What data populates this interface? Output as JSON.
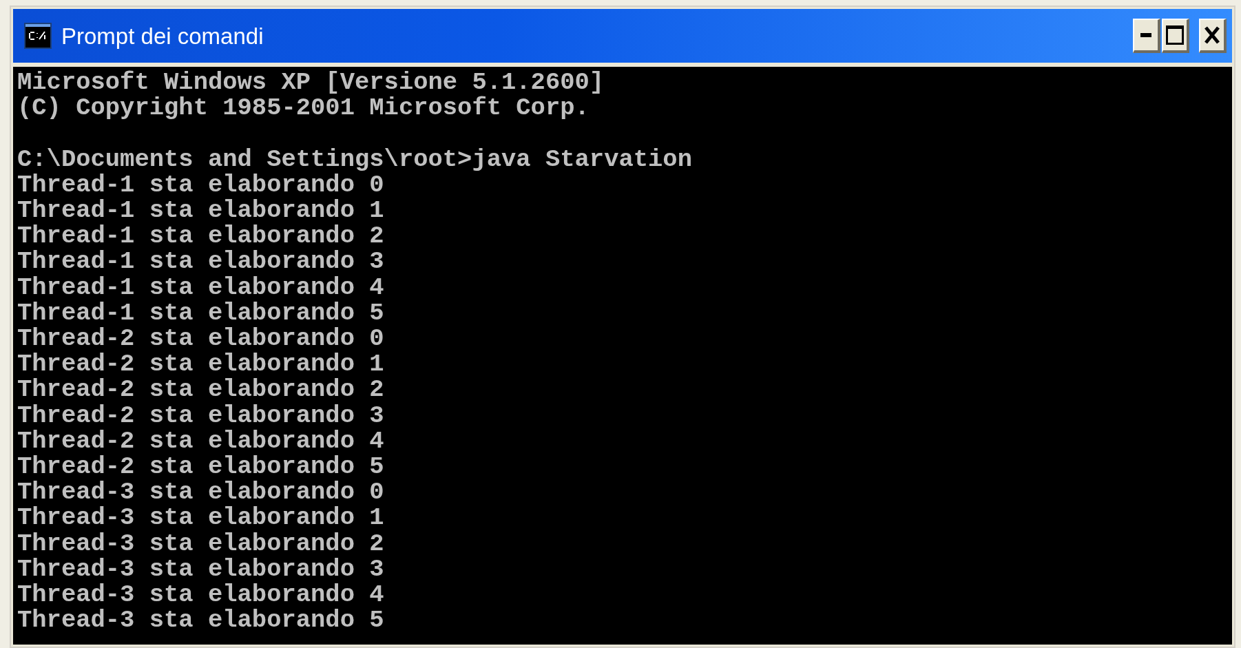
{
  "window": {
    "title": "Prompt dei comandi"
  },
  "console": {
    "blocks": [
      [
        "Microsoft Windows XP [Versione 5.1.2600]",
        "(C) Copyright 1985-2001 Microsoft Corp."
      ],
      [
        "C:\\Documents and Settings\\root>java Starvation",
        "Thread-1 sta elaborando 0",
        "Thread-1 sta elaborando 1",
        "Thread-1 sta elaborando 2",
        "Thread-1 sta elaborando 3",
        "Thread-1 sta elaborando 4",
        "Thread-1 sta elaborando 5",
        "Thread-2 sta elaborando 0",
        "Thread-2 sta elaborando 1",
        "Thread-2 sta elaborando 2",
        "Thread-2 sta elaborando 3",
        "Thread-2 sta elaborando 4",
        "Thread-2 sta elaborando 5",
        "Thread-3 sta elaborando 0",
        "Thread-3 sta elaborando 1",
        "Thread-3 sta elaborando 2",
        "Thread-3 sta elaborando 3",
        "Thread-3 sta elaborando 4",
        "Thread-3 sta elaborando 5"
      ]
    ]
  }
}
